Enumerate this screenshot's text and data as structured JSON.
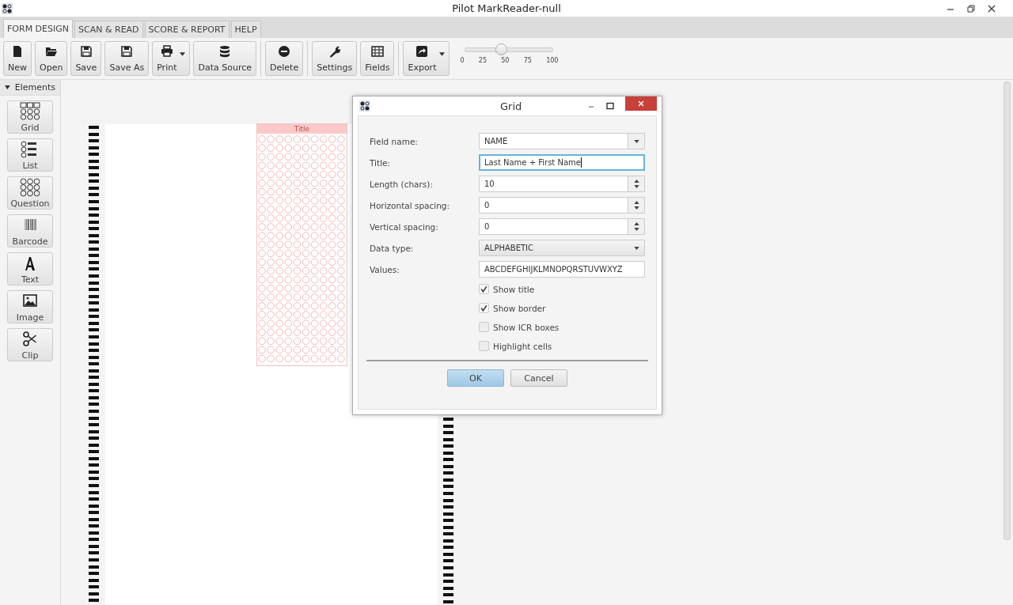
{
  "window": {
    "title": "Pilot MarkReader-null"
  },
  "tabs": [
    {
      "label": "FORM DESIGN",
      "selected": true
    },
    {
      "label": "SCAN & READ",
      "selected": false
    },
    {
      "label": "SCORE & REPORT",
      "selected": false
    },
    {
      "label": "HELP",
      "selected": false
    }
  ],
  "toolbar": {
    "groups": [
      [
        {
          "label": "New",
          "kind": "file",
          "dropdown": false
        },
        {
          "label": "Open",
          "kind": "folder",
          "dropdown": false
        },
        {
          "label": "Save",
          "kind": "disk",
          "dropdown": false
        },
        {
          "label": "Save As",
          "kind": "disk",
          "dropdown": false
        },
        {
          "label": "Print",
          "kind": "printer",
          "dropdown": true
        },
        {
          "label": "Data Source",
          "kind": "database",
          "dropdown": false
        }
      ],
      [
        {
          "label": "Delete",
          "kind": "minus",
          "dropdown": false
        }
      ],
      [
        {
          "label": "Settings",
          "kind": "wrench",
          "dropdown": false
        },
        {
          "label": "Fields",
          "kind": "table",
          "dropdown": false
        }
      ],
      [
        {
          "label": "Export",
          "kind": "share",
          "dropdown": true
        }
      ]
    ],
    "zoom_slider": {
      "level": 0.4,
      "ticks": [
        "0",
        "25",
        "50",
        "75",
        "100"
      ]
    }
  },
  "sidebar": {
    "header": "Elements",
    "expanded": true,
    "items": [
      {
        "label": "Grid",
        "kind": "grid"
      },
      {
        "label": "List",
        "kind": "list"
      },
      {
        "label": "Question",
        "kind": "question"
      },
      {
        "label": "Barcode",
        "kind": "barcode"
      },
      {
        "label": "Text",
        "kind": "text"
      },
      {
        "label": "Image",
        "kind": "image"
      },
      {
        "label": "Clip",
        "kind": "scissors"
      }
    ]
  },
  "form": {
    "grid_title": "Title"
  },
  "dialog": {
    "title": "Grid",
    "fields": [
      {
        "label": "Field name:",
        "kind": "combo",
        "value": "NAME",
        "focused": false
      },
      {
        "label": "Title:",
        "kind": "text",
        "value": "Last Name + First Name",
        "focused": true
      },
      {
        "label": "Length (chars):",
        "kind": "spinner",
        "value": "10",
        "focused": false
      },
      {
        "label": "Horizontal spacing:",
        "kind": "spinner",
        "value": "0",
        "focused": false
      },
      {
        "label": "Vertical spacing:",
        "kind": "spinner",
        "value": "0",
        "focused": false
      },
      {
        "label": "Data type:",
        "kind": "select",
        "value": "ALPHABETIC",
        "focused": false
      },
      {
        "label": "Values:",
        "kind": "text",
        "value": "ABCDEFGHIJKLMNOPQRSTUVWXYZ",
        "focused": false
      }
    ],
    "checkboxes": [
      {
        "label": "Show title",
        "checked": true
      },
      {
        "label": "Show border",
        "checked": true
      },
      {
        "label": "Show ICR boxes",
        "checked": false
      },
      {
        "label": "Highlight cells",
        "checked": false
      }
    ],
    "buttons": [
      {
        "label": "OK",
        "default": true
      },
      {
        "label": "Cancel",
        "default": false
      }
    ]
  }
}
